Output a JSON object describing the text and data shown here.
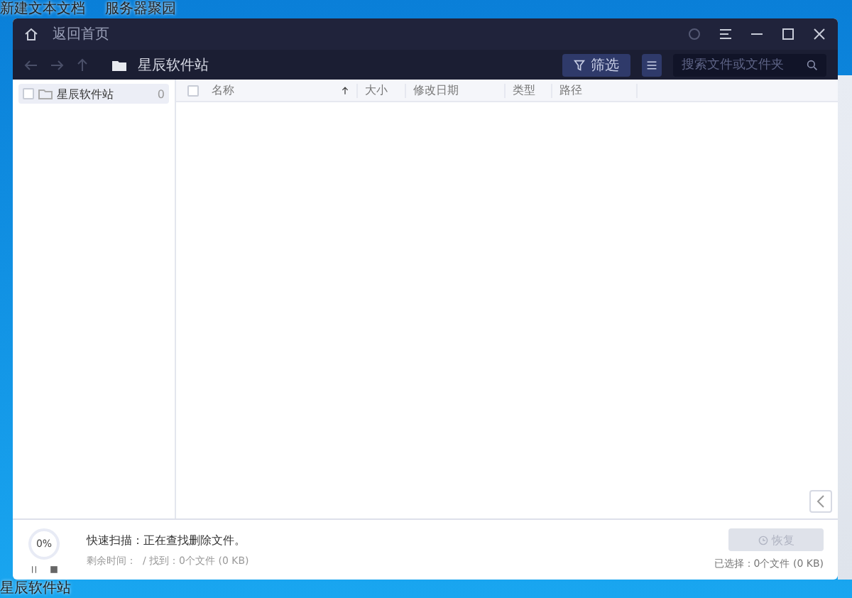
{
  "desktop": {
    "top_labels": [
      "新建文本文档",
      "服务器聚园"
    ],
    "bottom_label": "星辰软件站"
  },
  "window": {
    "title": "返回首页"
  },
  "toolbar": {
    "breadcrumb": "星辰软件站",
    "filter_button": "筛选",
    "search": {
      "placeholder": "搜索文件或文件夹"
    }
  },
  "sidebar": {
    "items": [
      {
        "label": "星辰软件站",
        "count": "0",
        "selected": true,
        "checked": false
      }
    ]
  },
  "table": {
    "select_all_checked": false,
    "columns": [
      {
        "label": "名称",
        "sorted": true
      },
      {
        "label": "大小",
        "sorted": false
      },
      {
        "label": "修改日期",
        "sorted": false
      },
      {
        "label": "类型",
        "sorted": false
      },
      {
        "label": "路径",
        "sorted": false
      }
    ]
  },
  "status": {
    "progress": "0%",
    "level": 0,
    "title": "快速扫描：正在查找删除文件。",
    "detail": "剩余时间：  / 找到：0个文件 (0 KB)",
    "restore_button": "恢复",
    "restore_disabled": true,
    "selection": "已选择：0个文件 (0 KB)"
  }
}
